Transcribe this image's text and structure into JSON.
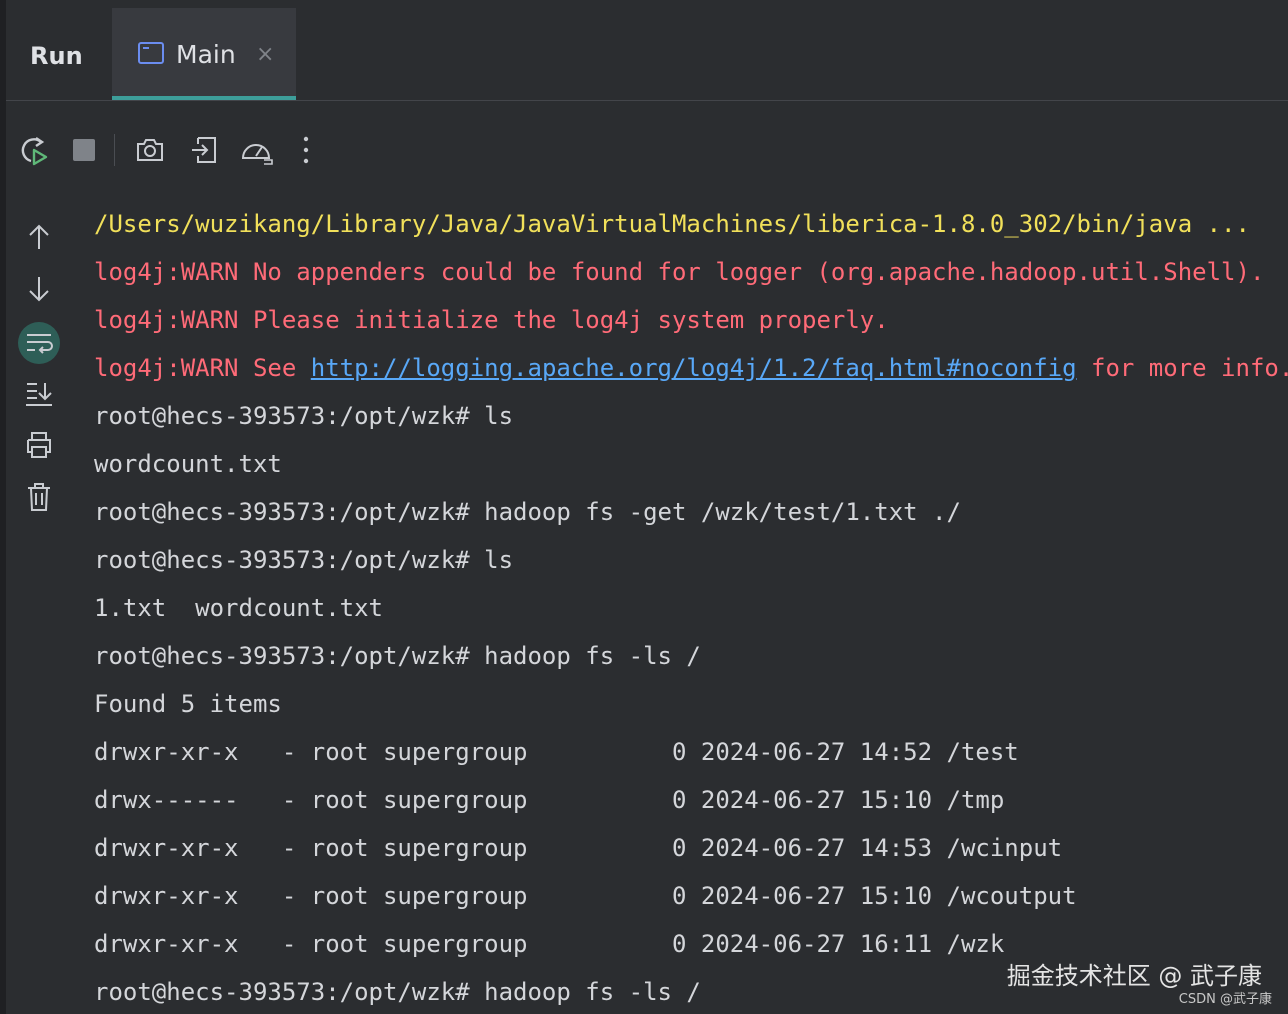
{
  "tabbar": {
    "run_label": "Run",
    "tab_main": "Main",
    "close_glyph": "×"
  },
  "toolbar": {
    "icons": [
      "rerun-icon",
      "stop-icon",
      "screenshot-icon",
      "exit-icon",
      "profiler-icon",
      "more-icon"
    ]
  },
  "sidebar": {
    "icons": [
      "arrow-up-icon",
      "arrow-down-icon",
      "soft-wrap-icon",
      "scroll-to-end-icon",
      "print-icon",
      "trash-icon"
    ]
  },
  "console": {
    "lines": [
      {
        "text": "/Users/wuzikang/Library/Java/JavaVirtualMachines/liberica-1.8.0_302/bin/java ...",
        "style": "yellow"
      },
      {
        "text": "log4j:WARN No appenders could be found for logger (org.apache.hadoop.util.Shell).",
        "style": "red"
      },
      {
        "text": "log4j:WARN Please initialize the log4j system properly.",
        "style": "red"
      },
      {
        "text": "log4j:WARN See ",
        "style": "red",
        "link": "http://logging.apache.org/log4j/1.2/faq.html#noconfig",
        "suffix": " for more info."
      },
      {
        "text": "root@hecs-393573:/opt/wzk# ls",
        "style": "normal"
      },
      {
        "text": "wordcount.txt",
        "style": "normal"
      },
      {
        "text": "root@hecs-393573:/opt/wzk# hadoop fs -get /wzk/test/1.txt ./",
        "style": "normal"
      },
      {
        "text": "root@hecs-393573:/opt/wzk# ls",
        "style": "normal"
      },
      {
        "text": "1.txt  wordcount.txt",
        "style": "normal"
      },
      {
        "text": "root@hecs-393573:/opt/wzk# hadoop fs -ls /",
        "style": "normal"
      },
      {
        "text": "Found 5 items",
        "style": "normal"
      },
      {
        "text": "drwxr-xr-x   - root supergroup          0 2024-06-27 14:52 /test",
        "style": "normal"
      },
      {
        "text": "drwx------   - root supergroup          0 2024-06-27 15:10 /tmp",
        "style": "normal"
      },
      {
        "text": "drwxr-xr-x   - root supergroup          0 2024-06-27 14:53 /wcinput",
        "style": "normal"
      },
      {
        "text": "drwxr-xr-x   - root supergroup          0 2024-06-27 15:10 /wcoutput",
        "style": "normal"
      },
      {
        "text": "drwxr-xr-x   - root supergroup          0 2024-06-27 16:11 /wzk",
        "style": "normal"
      },
      {
        "text": "root@hecs-393573:/opt/wzk# hadoop fs -ls /",
        "style": "normal"
      }
    ]
  },
  "watermark": {
    "main": "掘金技术社区 @ 武子康",
    "sub": "CSDN @武子康"
  },
  "colors": {
    "background": "#2b2d30",
    "accent_tab": "#3d9e9a",
    "path_yellow": "#f1e05a",
    "warn_red": "#ff6b78",
    "link_blue": "#59a8f7"
  }
}
